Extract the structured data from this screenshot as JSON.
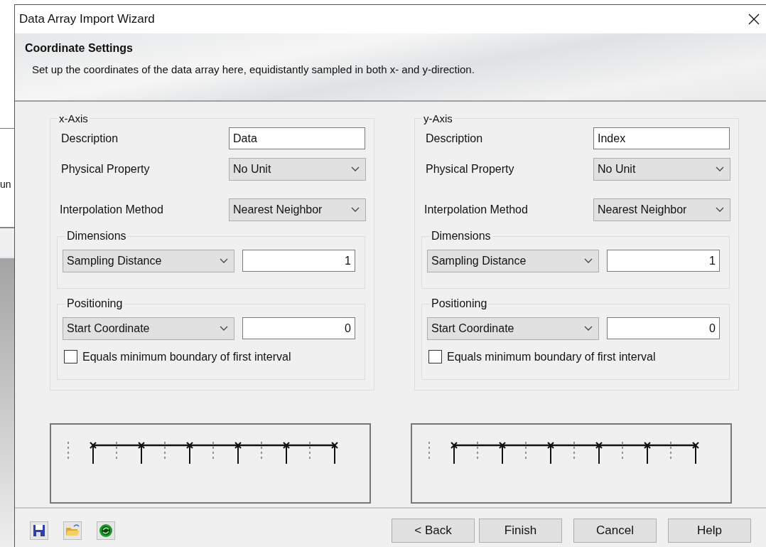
{
  "background_window": {
    "text": "un"
  },
  "window": {
    "title": "Data Array Import Wizard"
  },
  "header": {
    "title": "Coordinate Settings",
    "description": "Set up the coordinates of the data array here, equidistantly sampled in both x- and y-direction."
  },
  "axes": [
    {
      "title": "x-Axis",
      "description_label": "Description",
      "description_value": "Data",
      "property_label": "Physical Property",
      "property_value": "No Unit",
      "interpolation_label": "Interpolation Method",
      "interpolation_value": "Nearest Neighbor",
      "dimensions": {
        "title": "Dimensions",
        "mode": "Sampling Distance",
        "value": "1"
      },
      "positioning": {
        "title": "Positioning",
        "mode": "Start Coordinate",
        "value": "0",
        "checkbox_label": "Equals minimum boundary of first interval",
        "checked": false
      }
    },
    {
      "title": "y-Axis",
      "description_label": "Description",
      "description_value": "Index",
      "property_label": "Physical Property",
      "property_value": "No Unit",
      "interpolation_label": "Interpolation Method",
      "interpolation_value": "Nearest Neighbor",
      "dimensions": {
        "title": "Dimensions",
        "mode": "Sampling Distance",
        "value": "1"
      },
      "positioning": {
        "title": "Positioning",
        "mode": "Start Coordinate",
        "value": "0",
        "checkbox_label": "Equals minimum boundary of first interval",
        "checked": false
      }
    }
  ],
  "buttons": [
    {
      "label": "< Back"
    },
    {
      "label": "Finish"
    },
    {
      "label": "Cancel"
    },
    {
      "label": "Help"
    }
  ]
}
